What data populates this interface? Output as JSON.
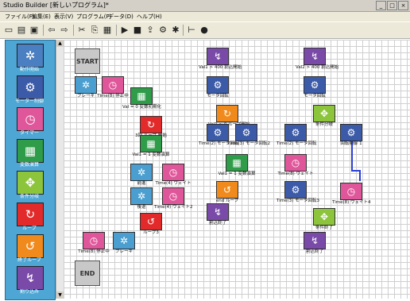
{
  "window": {
    "title": "Studio Builder [新しいプログラム]*",
    "buttons": [
      "_",
      "□",
      "×"
    ]
  },
  "menubar": {
    "items": [
      "ファイル(F)",
      "編集(E)",
      "表示(V)",
      "プログラム(P)",
      "データ(D)",
      "ヘルプ(H)"
    ]
  },
  "toolbar": {
    "buttons": [
      {
        "name": "new-file-icon",
        "glyph": "▭"
      },
      {
        "name": "open-folder-icon",
        "glyph": "▤"
      },
      {
        "name": "save-icon",
        "glyph": "▣"
      },
      {
        "name": "back-arrow-icon",
        "glyph": "⇦"
      },
      {
        "name": "forward-arrow-icon",
        "glyph": "⇨"
      },
      {
        "name": "cut-icon",
        "glyph": "✂"
      },
      {
        "name": "copy-icon",
        "glyph": "⎘"
      },
      {
        "name": "paste-icon",
        "glyph": "▦"
      },
      {
        "name": "run-icon",
        "glyph": "▶"
      },
      {
        "name": "stop-icon",
        "glyph": "■"
      },
      {
        "name": "transfer-icon",
        "glyph": "⇪"
      },
      {
        "name": "settings-icon",
        "glyph": "⚙"
      },
      {
        "name": "bulb-icon",
        "glyph": "✱"
      },
      {
        "name": "chart-icon",
        "glyph": "⊢"
      },
      {
        "name": "record-icon",
        "glyph": "●"
      }
    ]
  },
  "palette": {
    "items": [
      {
        "label": "動作開始",
        "color": "#4a7fc1",
        "glyph": "✲"
      },
      {
        "label": "モーター制御",
        "color": "#3b5aa8",
        "glyph": "⚙"
      },
      {
        "label": "タイマー",
        "color": "#e0569a",
        "glyph": "◷"
      },
      {
        "label": "変数演算",
        "color": "#2e9c48",
        "glyph": "▦"
      },
      {
        "label": "条件分岐",
        "color": "#8cc43c",
        "glyph": "✥"
      },
      {
        "label": "ループ",
        "color": "#e32a2a",
        "glyph": "↻"
      },
      {
        "label": "終了ループ",
        "color": "#f08a1c",
        "glyph": "↺"
      },
      {
        "label": "割り込み",
        "color": "#7a4aa8",
        "glyph": "↯"
      }
    ]
  },
  "canvas": {
    "start_label": "START",
    "end_label": "END",
    "blocks": [
      {
        "glyph": "✲",
        "color": "#4a9fd0",
        "label": "ブレーキ"
      },
      {
        "glyph": "◷",
        "color": "#e0569a",
        "label": "Time(8) 停止中"
      },
      {
        "glyph": "▦",
        "color": "#2e9c48",
        "label": "Val = 0 変数初期化"
      },
      {
        "glyph": "↻",
        "color": "#e32a2a",
        "label": "3回 ループ 開始"
      },
      {
        "glyph": "▦",
        "color": "#2e9c48",
        "label": "Val1 = 1 変数演算"
      },
      {
        "glyph": "✲",
        "color": "#4a9fd0",
        "label": "前進"
      },
      {
        "glyph": "◷",
        "color": "#e0569a",
        "label": "Time(4) ウェイト"
      },
      {
        "glyph": "✲",
        "color": "#4a9fd0",
        "label": "後退"
      },
      {
        "glyph": "◷",
        "color": "#e0569a",
        "label": "Time(4) ウェイト2"
      },
      {
        "glyph": "↺",
        "color": "#e32a2a",
        "label": "ループ3"
      },
      {
        "glyph": "◷",
        "color": "#e0569a",
        "label": "Time(8) 停止中"
      },
      {
        "glyph": "✲",
        "color": "#4a9fd0",
        "label": "ブレーキ"
      },
      {
        "glyph": "↯",
        "color": "#7a4aa8",
        "label": "Val1 > 400 割込開始"
      },
      {
        "glyph": "⚙",
        "color": "#3b5aa8",
        "label": "モータ回転"
      },
      {
        "glyph": "↻",
        "color": "#f08a1c",
        "label": "Val1 > 0 ループ開始"
      },
      {
        "glyph": "⚙",
        "color": "#3b5aa8",
        "label": "Time(2) モータ回転"
      },
      {
        "glyph": "⚙",
        "color": "#3b5aa8",
        "label": "Time(3) モータ回転2"
      },
      {
        "glyph": "▦",
        "color": "#2e9c48",
        "label": "Val1 = 1 変数演算"
      },
      {
        "glyph": "↺",
        "color": "#f08a1c",
        "label": "end ループ"
      },
      {
        "glyph": "↯",
        "color": "#7a4aa8",
        "label": "割込終了"
      },
      {
        "glyph": "↯",
        "color": "#7a4aa8",
        "label": "Val2 > 400 割込開始"
      },
      {
        "glyph": "⚙",
        "color": "#3b5aa8",
        "label": "モータ回転"
      },
      {
        "glyph": "✥",
        "color": "#8cc43c",
        "label": "条件分岐"
      },
      {
        "glyph": "⚙",
        "color": "#3b5aa8",
        "label": "Time(2) モータ回転"
      },
      {
        "glyph": "⚙",
        "color": "#3b5aa8",
        "label": "回転制御 1"
      },
      {
        "glyph": "◷",
        "color": "#e0569a",
        "label": "Time(8) ウェイト"
      },
      {
        "glyph": "⚙",
        "color": "#3b5aa8",
        "label": "Time(3) モータ回転3"
      },
      {
        "glyph": "◷",
        "color": "#e0569a",
        "label": "Time(8) ウェイト4"
      },
      {
        "glyph": "✥",
        "color": "#8cc43c",
        "label": "条件終了"
      },
      {
        "glyph": "↯",
        "color": "#7a4aa8",
        "label": "割込終了"
      }
    ]
  }
}
